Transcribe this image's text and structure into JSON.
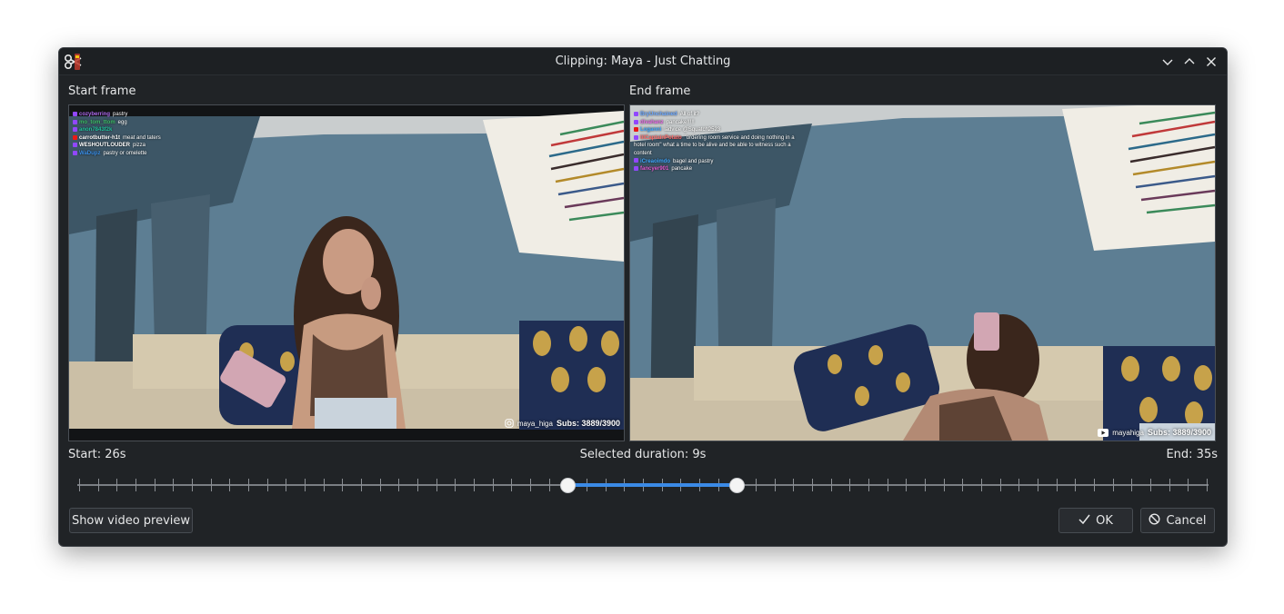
{
  "window": {
    "title": "Clipping: Maya - Just Chatting"
  },
  "icons": {
    "app": "scissors-app-icon",
    "minimize": "chevron-down-icon",
    "maximize": "chevron-up-icon",
    "close": "close-icon"
  },
  "start_frame": {
    "label": "Start frame",
    "chat": [
      {
        "user": "cozyberring",
        "msg": "pastry",
        "color": "#b06bf0"
      },
      {
        "user": "mo_tom_ttom",
        "msg": "egg",
        "color": "#3fbf6a"
      },
      {
        "user": "anon7843f2k",
        "msg": "",
        "color": "#23c19a"
      },
      {
        "user": "carrotbutter-h1t",
        "msg": "meat and taters",
        "color": "#ffffff"
      },
      {
        "user": "WESHOUTLOUDER",
        "msg": "pizza",
        "color": "#ffffff"
      },
      {
        "user": "WaDupz",
        "msg": "pastry or omelette",
        "color": "#3a8ee6"
      }
    ],
    "overlay_handle": "maya_higa",
    "overlay_subs": "Subs: 3889/3900"
  },
  "end_frame": {
    "label": "End frame",
    "chat": [
      {
        "user": "BryUnchained",
        "msg": "All of it?",
        "color": "#6aa7ff"
      },
      {
        "user": "divahanz",
        "msg": "pancake!!!!!",
        "color": "#e66ae6"
      },
      {
        "user": "Loganni",
        "msg": "ladvice @Squatch2523",
        "color": "#3fa8ff"
      },
      {
        "user": "lilCaptainPotato",
        "msg": "\"ordering room service and doing nothing in a hotel room\" what a time to be alive and be able to witness such a content",
        "color": "#ff6a6a"
      },
      {
        "user": "iCreaoimdo",
        "msg": "bagel and pastry",
        "color": "#3fa8ff"
      },
      {
        "user": "fancyer901",
        "msg": "pancake",
        "color": "#e65ad1"
      }
    ],
    "overlay_handle": "mayahiga",
    "overlay_subs": "Subs: 3889/3900"
  },
  "timing": {
    "start": "Start: 26s",
    "duration": "Selected duration: 9s",
    "end": "End: 35s"
  },
  "slider": {
    "total_ticks": 61,
    "start_tick": 26,
    "end_tick": 35,
    "accent": "#3b8ae6"
  },
  "buttons": {
    "preview": "Show video preview",
    "ok": "OK",
    "cancel": "Cancel"
  }
}
